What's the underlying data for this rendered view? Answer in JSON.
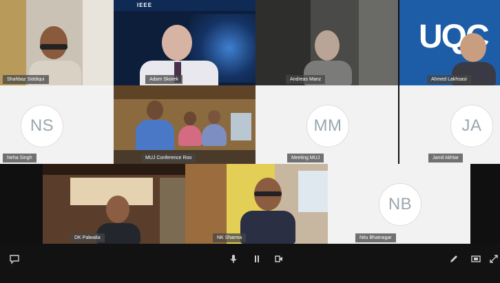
{
  "participants": {
    "tile1": {
      "name": "Shahbaz Siddiqui"
    },
    "tile2": {
      "name": "Adam Skorek",
      "banner": "IEEE"
    },
    "tile3": {
      "name": "Andreas Manz"
    },
    "tile4": {
      "name": "Ahmed Lakhsasi",
      "brand_text": "UQC"
    },
    "tile5": {
      "initials": "NS",
      "name": "Neha Singh"
    },
    "tile6": {
      "name": "MUJ Conference Roo"
    },
    "tile7": {
      "initials": "MM",
      "name": "Meeting MUJ"
    },
    "tile8": {
      "initials": "JA",
      "name": "Jamil Akhtar"
    },
    "tile9": {
      "name": "DK Palwalia"
    },
    "tile10": {
      "name": "NK Sharma"
    },
    "tile11": {
      "initials": "NB",
      "name": "Nitu Bhatnagar"
    }
  },
  "controls": {
    "chat_icon": "speech-bubble",
    "mic_icon": "microphone",
    "pause_icon": "pause",
    "camera_icon": "camera",
    "pen_icon": "pen",
    "screen_icon": "screen",
    "expand_icon": "expand"
  }
}
